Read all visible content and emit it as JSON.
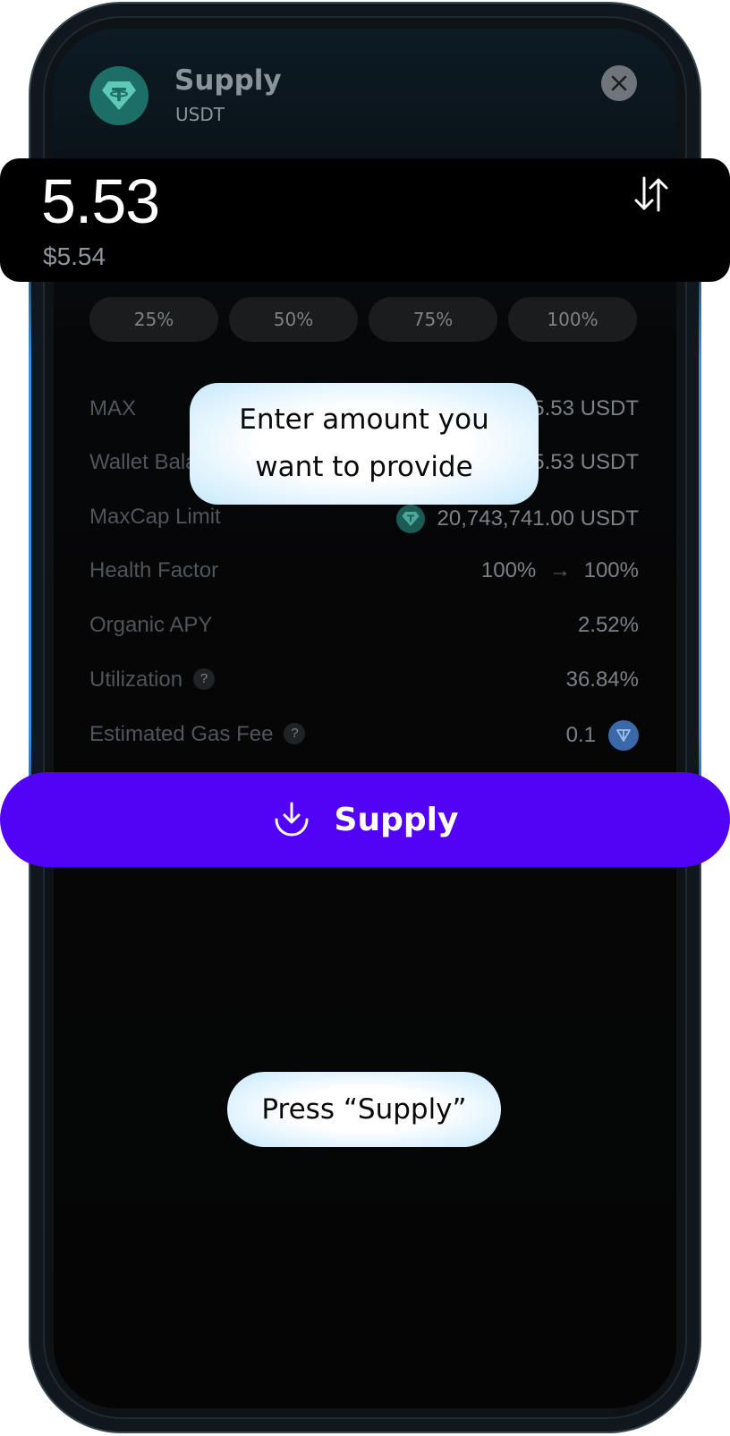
{
  "header": {
    "title": "Supply",
    "subtitle": "USDT",
    "token_icon": "usdt-icon",
    "close_icon": "close-icon"
  },
  "amount": {
    "value": "5.53",
    "usd_value": "$5.54",
    "swap_icon": "swap-arrows-icon"
  },
  "percent_buttons": [
    "25%",
    "50%",
    "75%",
    "100%"
  ],
  "details": {
    "max": {
      "label": "MAX",
      "value": "5.53 USDT"
    },
    "wallet_balance": {
      "label": "Wallet Balance",
      "value": "5.53 USDT"
    },
    "maxcap": {
      "label": "MaxCap Limit",
      "value": "20,743,741.00 USDT"
    },
    "health_factor": {
      "label": "Health Factor",
      "from": "100%",
      "arrow": "→",
      "to": "100%"
    },
    "organic_apy": {
      "label": "Organic APY",
      "value": "2.52%"
    },
    "utilization": {
      "label": "Utilization",
      "help": "?",
      "value": "36.84%"
    },
    "gas_fee": {
      "label": "Estimated Gas Fee",
      "help": "?",
      "value": "0.1",
      "token_icon": "ton-icon"
    }
  },
  "supply_button": {
    "label": "Supply",
    "icon": "download-icon"
  },
  "tooltips": {
    "amount_line1": "Enter amount you",
    "amount_line2": "want to provide",
    "press": "Press “Supply”"
  },
  "colors": {
    "accent": "#5203f6",
    "usdt": "#1c6e66",
    "tooltip": "#c7e9fc"
  }
}
